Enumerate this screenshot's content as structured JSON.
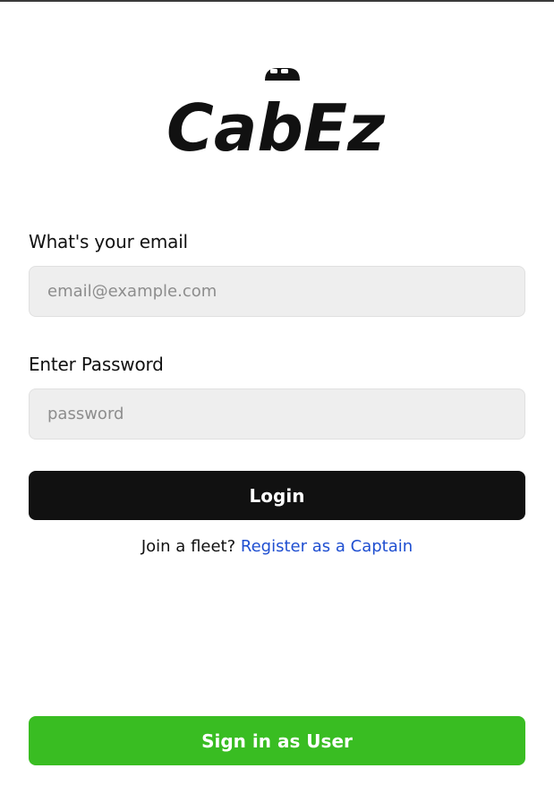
{
  "brand": {
    "logo_text": "CabEz",
    "logo_icon": "car-silhouette-icon"
  },
  "login_form": {
    "email_label": "What's your email",
    "email_value": "",
    "email_placeholder": "email@example.com",
    "password_label": "Enter Password",
    "password_value": "",
    "password_placeholder": "password",
    "login_label": "Login"
  },
  "join": {
    "prompt": "Join a fleet?",
    "register_link": "Register as a Captain"
  },
  "footer": {
    "user_signin_label": "Sign in as User"
  },
  "colors": {
    "primary_button": "#111111",
    "user_button": "#39bd22",
    "link": "#1f4fd1",
    "input_background": "#eeeeee"
  }
}
